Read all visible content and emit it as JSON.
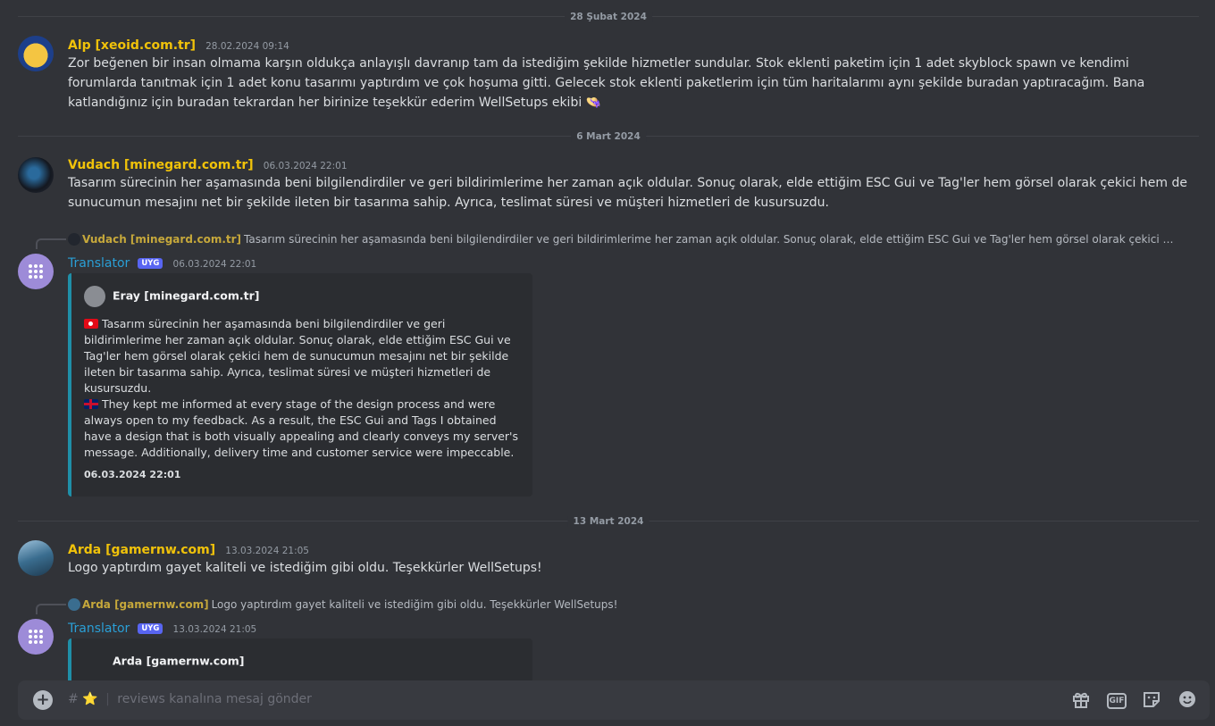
{
  "dividers": [
    "28 Şubat 2024",
    "6 Mart 2024",
    "13 Mart 2024"
  ],
  "messages": [
    {
      "author": "Alp [xeoid.com.tr]",
      "author_color": "#f0c20a",
      "timestamp": "28.02.2024 09:14",
      "text": "Zor beğenen bir insan olmama karşın oldukça anlayışlı davranıp tam da istediğim şekilde hizmetler sundular. Stok eklenti paketim için 1 adet skyblock spawn ve kendimi forumlarda tanıtmak için 1 adet konu tasarımı yaptırdım ve çok hoşuma gitti. Gelecek stok eklenti paketlerim için tüm haritalarımı aynı şekilde buradan yaptıracağım. Bana katlandığınız için buradan tekrardan her birinize teşekkür ederim WellSetups ekibi 👒"
    },
    {
      "author": "Vudach [minegard.com.tr]",
      "author_color": "#f0c20a",
      "timestamp": "06.03.2024 22:01",
      "text": "Tasarım sürecinin her aşamasında beni bilgilendirdiler ve geri bildirimlerime her zaman açık oldular. Sonuç olarak, elde ettiğim ESC Gui ve Tag'ler hem görsel olarak çekici hem de sunucumun mesajını net bir şekilde ileten bir tasarıma sahip. Ayrıca, teslimat süresi ve müşteri hizmetleri de kusursuzdu."
    },
    {
      "author": "Arda [gamernw.com]",
      "author_color": "#f0c20a",
      "timestamp": "13.03.2024 21:05",
      "text": "Logo yaptırdım gayet kaliteli ve istediğim gibi oldu. Teşekkürler WellSetups!"
    }
  ],
  "translations": [
    {
      "reply_author": "Vudach [minegard.com.tr]",
      "reply_text": "Tasarım sürecinin her aşamasında beni bilgilendirdiler ve geri bildirimlerime her zaman açık oldular. Sonuç olarak, elde ettiğim ESC Gui ve Tag'ler hem görsel olarak çekici hem de sunucumun mesajını net bir şekilde ileten bir tasarıma sahip. Ayrıca, teslimat süresi ve müşteri hizmetleri de kusursuzdu.",
      "bot_name": "Translator",
      "bot_color": "#2a9fd6",
      "bot_badge": "UYG",
      "timestamp": "06.03.2024 22:01",
      "embed_author": "Eray [minegard.com.tr]",
      "tr_text": "Tasarım sürecinin her aşamasında beni bilgilendirdiler ve geri bildirimlerime her zaman açık oldular. Sonuç olarak, elde ettiğim ESC Gui ve Tag'ler hem görsel olarak çekici hem de sunucumun mesajını net bir şekilde ileten bir tasarıma sahip. Ayrıca, teslimat süresi ve müşteri hizmetleri de kusursuzdu.",
      "en_text": "They kept me informed at every stage of the design process and were always open to my feedback. As a result, the ESC Gui and Tags I obtained have a design that is both visually appealing and clearly conveys my server's message. Additionally, delivery time and customer service were impeccable.",
      "footer": "06.03.2024 22:01"
    },
    {
      "reply_author": "Arda [gamernw.com]",
      "reply_text": "Logo yaptırdım gayet kaliteli ve istediğim gibi oldu. Teşekkürler WellSetups!",
      "bot_name": "Translator",
      "bot_color": "#2a9fd6",
      "bot_badge": "UYG",
      "timestamp": "13.03.2024 21:05",
      "embed_author": "Arda [gamernw.com]"
    }
  ],
  "composer": {
    "channel_prefix": "#",
    "channel_emoji": "⭐",
    "placeholder": "reviews kanalına mesaj gönder",
    "gif_label": "GIF"
  },
  "colors": {
    "background": "#313338",
    "embed_accent": "#1f8fa8",
    "badge": "#5865f2"
  }
}
